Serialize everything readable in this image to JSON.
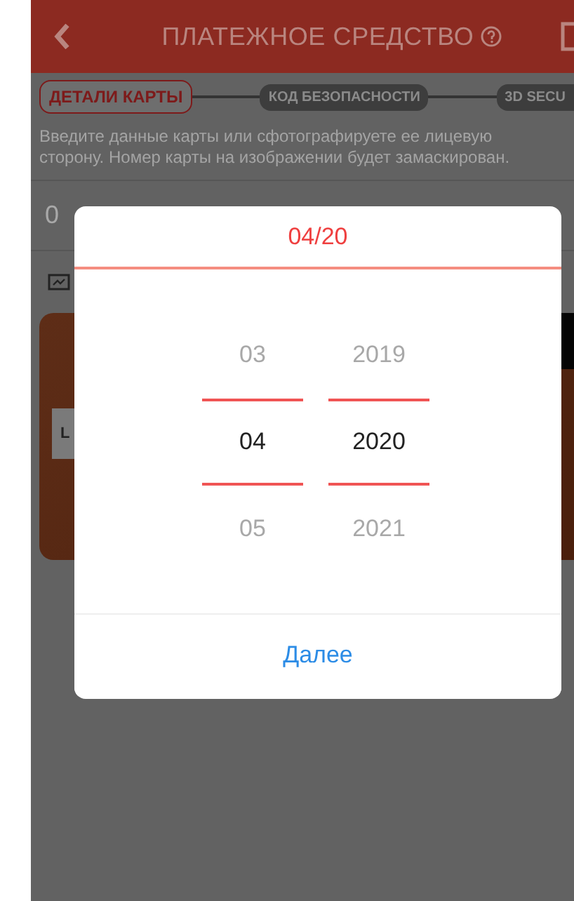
{
  "header": {
    "title": "ПЛАТЕЖНОЕ СРЕДСТВО"
  },
  "steps": [
    {
      "label": "ДЕТАЛИ КАРТЫ",
      "selected": true
    },
    {
      "label": "КОД БЕЗОПАСНОСТИ",
      "selected": false
    },
    {
      "label": "3D SECU",
      "selected": false
    }
  ],
  "instructions": "Введите данные карты или сфотографируете ее лицевую сторону. Номер карты на изображении будет замаскирован.",
  "card_number": {
    "value": "0"
  },
  "card_preview": {
    "label": "L"
  },
  "dialog": {
    "title": "04/20",
    "columns": [
      {
        "options": [
          {
            "label": "03",
            "selected": false
          },
          {
            "label": "04",
            "selected": true
          },
          {
            "label": "05",
            "selected": false
          }
        ]
      },
      {
        "options": [
          {
            "label": "2019",
            "selected": false
          },
          {
            "label": "2020",
            "selected": true
          },
          {
            "label": "2021",
            "selected": false
          }
        ]
      }
    ],
    "button": "Далее"
  }
}
